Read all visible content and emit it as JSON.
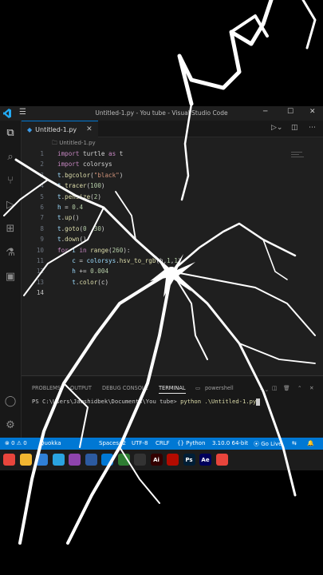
{
  "window": {
    "title": "Untitled-1.py - You tube - Visual Studio Code",
    "menu_icon": "hamburger-menu-icon",
    "controls": {
      "minimize": "─",
      "maximize": "☐",
      "close": "✕"
    }
  },
  "tab": {
    "label": "Untitled-1.py",
    "close": "✕",
    "language_icon": "python-icon"
  },
  "breadcrumb": "🗀 Untitled-1.py",
  "editor": {
    "line_numbers": [
      "1",
      "2",
      "3",
      "4",
      "5",
      "6",
      "7",
      "8",
      "9",
      "10",
      "11",
      "12",
      "13",
      "14"
    ],
    "lines": [
      [
        {
          "t": "import",
          "c": "kw"
        },
        {
          "t": " turtle ",
          "c": "pl"
        },
        {
          "t": "as",
          "c": "kw"
        },
        {
          "t": " t",
          "c": "pl"
        }
      ],
      [
        {
          "t": "import",
          "c": "kw"
        },
        {
          "t": " colorsys",
          "c": "pl"
        }
      ],
      [
        {
          "t": "t",
          "c": "id"
        },
        {
          "t": ".",
          "c": "pl"
        },
        {
          "t": "bgcolor",
          "c": "fn"
        },
        {
          "t": "(",
          "c": "pl"
        },
        {
          "t": "\"black\"",
          "c": "str"
        },
        {
          "t": ")",
          "c": "pl"
        }
      ],
      [
        {
          "t": "t",
          "c": "id"
        },
        {
          "t": ".",
          "c": "pl"
        },
        {
          "t": "tracer",
          "c": "fn"
        },
        {
          "t": "(",
          "c": "pl"
        },
        {
          "t": "100",
          "c": "num"
        },
        {
          "t": ")",
          "c": "pl"
        }
      ],
      [
        {
          "t": "t",
          "c": "id"
        },
        {
          "t": ".",
          "c": "pl"
        },
        {
          "t": "pensize",
          "c": "fn"
        },
        {
          "t": "(",
          "c": "pl"
        },
        {
          "t": "2",
          "c": "num"
        },
        {
          "t": ")",
          "c": "pl"
        }
      ],
      [
        {
          "t": "h",
          "c": "id"
        },
        {
          "t": " = ",
          "c": "pl"
        },
        {
          "t": "0.4",
          "c": "num"
        }
      ],
      [
        {
          "t": "t",
          "c": "id"
        },
        {
          "t": ".",
          "c": "pl"
        },
        {
          "t": "up",
          "c": "fn"
        },
        {
          "t": "()",
          "c": "pl"
        }
      ],
      [
        {
          "t": "t",
          "c": "id"
        },
        {
          "t": ".",
          "c": "pl"
        },
        {
          "t": "goto",
          "c": "fn"
        },
        {
          "t": "(",
          "c": "pl"
        },
        {
          "t": "0",
          "c": "num"
        },
        {
          "t": " ,",
          "c": "pl"
        },
        {
          "t": "30",
          "c": "num"
        },
        {
          "t": ")",
          "c": "pl"
        }
      ],
      [
        {
          "t": "t",
          "c": "id"
        },
        {
          "t": ".",
          "c": "pl"
        },
        {
          "t": "down",
          "c": "fn"
        },
        {
          "t": "()",
          "c": "pl"
        }
      ],
      [
        {
          "t": "for",
          "c": "kw"
        },
        {
          "t": " i ",
          "c": "id"
        },
        {
          "t": "in",
          "c": "kw"
        },
        {
          "t": " ",
          "c": "pl"
        },
        {
          "t": "range",
          "c": "fn"
        },
        {
          "t": "(",
          "c": "pl"
        },
        {
          "t": "260",
          "c": "num"
        },
        {
          "t": "):",
          "c": "pl"
        }
      ],
      [
        {
          "t": "    c",
          "c": "id"
        },
        {
          "t": " = ",
          "c": "pl"
        },
        {
          "t": "colorsys",
          "c": "id"
        },
        {
          "t": ".",
          "c": "pl"
        },
        {
          "t": "hsv_to_rgb",
          "c": "fn"
        },
        {
          "t": "(h,",
          "c": "pl"
        },
        {
          "t": "1",
          "c": "num"
        },
        {
          "t": ",",
          "c": "pl"
        },
        {
          "t": "1",
          "c": "num"
        },
        {
          "t": ")",
          "c": "pl"
        }
      ],
      [
        {
          "t": "    h",
          "c": "id"
        },
        {
          "t": " += ",
          "c": "pl"
        },
        {
          "t": "0.004",
          "c": "num"
        }
      ],
      [
        {
          "t": "    t",
          "c": "id"
        },
        {
          "t": ".",
          "c": "pl"
        },
        {
          "t": "color",
          "c": "fn"
        },
        {
          "t": "(c)",
          "c": "pl"
        }
      ],
      []
    ]
  },
  "panel": {
    "tabs": [
      "PROBLEMS",
      "OUTPUT",
      "DEBUG CONSOLE",
      "TERMINAL"
    ],
    "active_tab": "TERMINAL",
    "terminal_name": "powershell",
    "prompt": "PS C:\\Users\\Jamshidbek\\Documents\\You tube> ",
    "command": "python .\\Untitled-1.py"
  },
  "status": {
    "errors": "⊗ 0  ⚠ 0",
    "quokka": "Quokka",
    "spaces": "Spaces: 2",
    "encoding": "UTF-8",
    "eol": "CRLF",
    "language": "{} Python",
    "interpreter": "3.10.0 64-bit",
    "golive": "⦿ Go Live"
  },
  "taskbar": {
    "apps": [
      {
        "name": "chrome-icon",
        "label": "",
        "color": "#e8453c"
      },
      {
        "name": "file-explorer-icon",
        "label": "",
        "color": "#f2b631"
      },
      {
        "name": "photos-icon",
        "label": "",
        "color": "#2f7fd6"
      },
      {
        "name": "telegram-icon",
        "label": "",
        "color": "#2aa3e0"
      },
      {
        "name": "vlc-icon",
        "label": "",
        "color": "#8e44ad"
      },
      {
        "name": "virtualbox-icon",
        "label": "",
        "color": "#2c5aa0"
      },
      {
        "name": "vscode-icon",
        "label": "",
        "color": "#0078d4"
      },
      {
        "name": "terminal-icon",
        "label": "",
        "color": "#2e7d32"
      },
      {
        "name": "capcut-icon",
        "label": "",
        "color": "#333333"
      },
      {
        "name": "illustrator-icon",
        "label": "Ai",
        "color": "#330000"
      },
      {
        "name": "acrobat-icon",
        "label": "",
        "color": "#b30b00"
      },
      {
        "name": "photoshop-icon",
        "label": "Ps",
        "color": "#001e36"
      },
      {
        "name": "after-effects-icon",
        "label": "Ae",
        "color": "#00005b"
      },
      {
        "name": "chrome-alt-icon",
        "label": "",
        "color": "#e8453c"
      }
    ]
  }
}
